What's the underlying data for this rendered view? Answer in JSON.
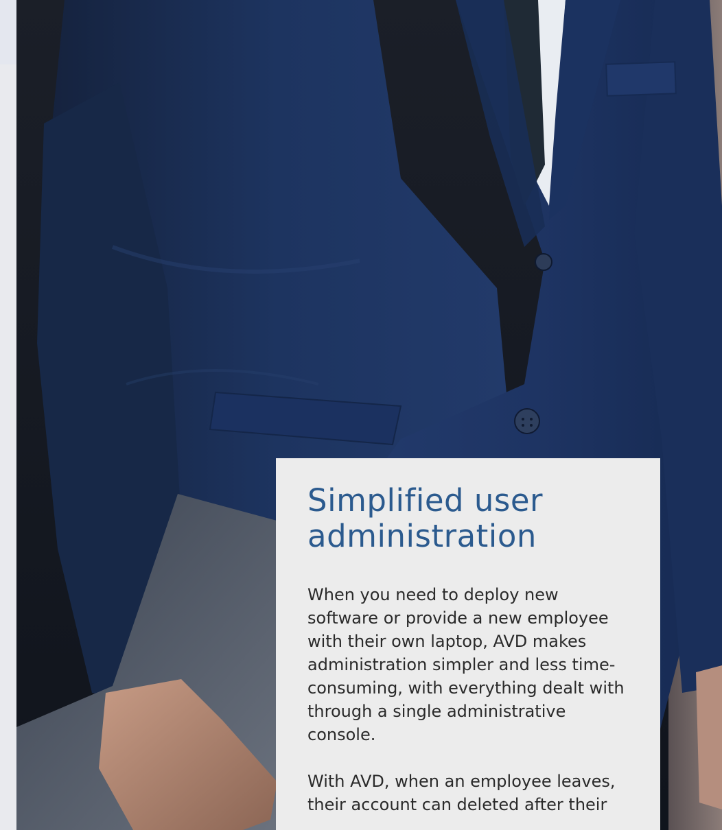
{
  "card": {
    "title": "Simplified user administration",
    "paragraphs": [
      "When you need to deploy new software or provide a new employee with their own laptop, AVD makes administration simpler and less time-consuming, with everything dealt with through a single administrative console.",
      "With AVD, when an employee leaves, their account can deleted after their"
    ]
  },
  "colors": {
    "title": "#2b5a8e",
    "card_background": "#ececec",
    "suit": "#1e3360"
  }
}
